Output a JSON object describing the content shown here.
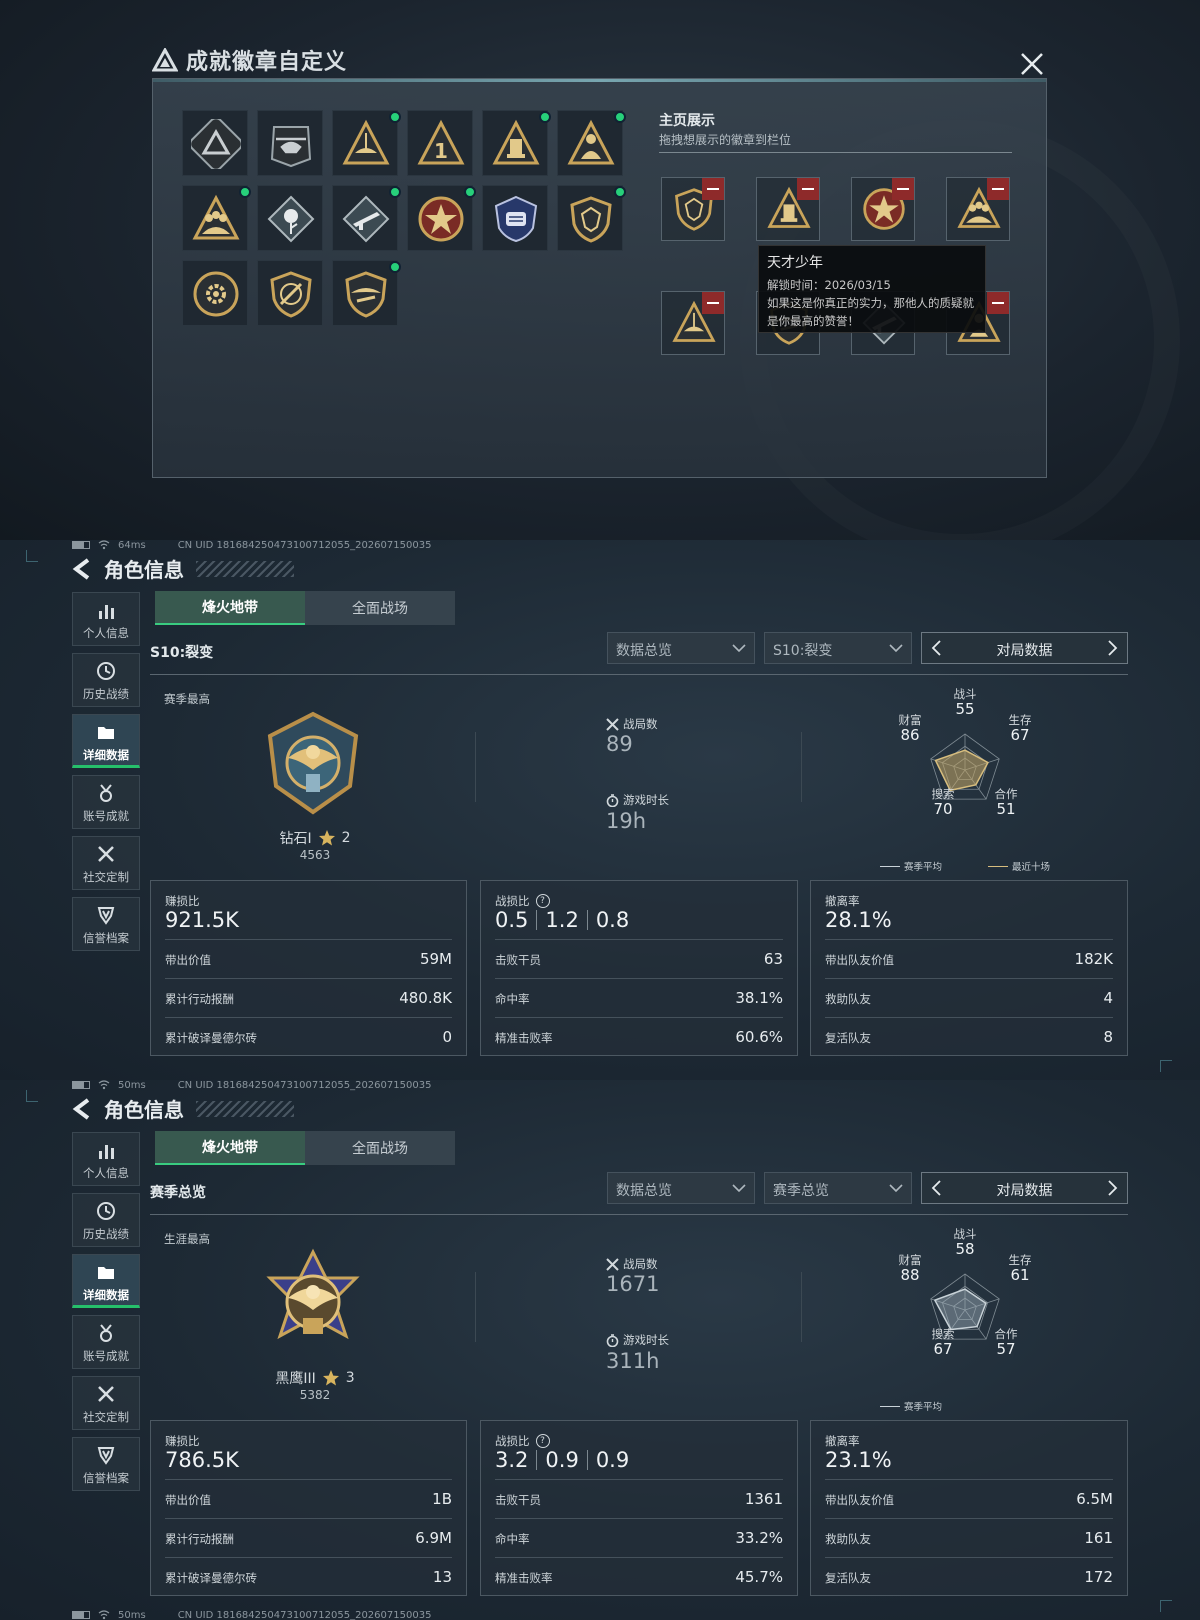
{
  "dialog": {
    "title": "成就徽章自定义",
    "showcase_title": "主页展示",
    "showcase_sub": "拖拽想展示的徽章到栏位",
    "tooltip": {
      "name": "天才少年",
      "unlock_time": "解锁时间：2026/03/15",
      "desc_line1": "如果这是你真正的实力，那他人的质疑就",
      "desc_line2": "是你最高的赞誉！"
    },
    "badges": [
      {
        "icon": "triangle-emblem",
        "new": false
      },
      {
        "icon": "helicopter-emblem",
        "new": false
      },
      {
        "icon": "boat-emblem",
        "new": true
      },
      {
        "icon": "number-one-emblem",
        "new": false
      },
      {
        "icon": "tower-emblem",
        "new": true
      },
      {
        "icon": "soldier-emblem",
        "new": true
      },
      {
        "icon": "squad-emblem",
        "new": true
      },
      {
        "icon": "rose-emblem",
        "new": false
      },
      {
        "icon": "rifle-emblem",
        "new": true
      },
      {
        "icon": "star-medal-emblem",
        "new": true
      },
      {
        "icon": "police-emblem",
        "new": false
      },
      {
        "icon": "shield-emblem",
        "new": true
      },
      {
        "icon": "cog-emblem",
        "new": false
      },
      {
        "icon": "no-knife-emblem",
        "new": false
      },
      {
        "icon": "wing-shield-emblem",
        "new": true
      }
    ],
    "slots": [
      {
        "icon": "shield-emblem",
        "removable": true
      },
      {
        "icon": "tower-emblem",
        "removable": true
      },
      {
        "icon": "star-medal-emblem",
        "removable": true
      },
      {
        "icon": "squad-emblem",
        "removable": true
      },
      {
        "icon": "boat-emblem",
        "removable": true
      },
      {
        "icon": "wing-shield-emblem",
        "removable": false
      },
      {
        "icon": "rifle-emblem",
        "removable": false
      },
      {
        "icon": "soldier-emblem",
        "removable": true
      }
    ]
  },
  "panels": [
    {
      "status": {
        "latency": "64ms",
        "uid": "CN UID 181684250473100712055_202607150035"
      },
      "header_title": "角色信息",
      "nav": [
        "个人信息",
        "历史战绩",
        "详细数据",
        "账号成就",
        "社交定制",
        "信誉档案"
      ],
      "active_nav": 2,
      "tabs": [
        "烽火地带",
        "全面战场"
      ],
      "section_title": "S10:裂变",
      "dropdown1": "数据总览",
      "dropdown2": "S10:裂变",
      "pager_label": "对局数据",
      "best_label": "赛季最高",
      "rank_name": "钻石I",
      "rank_stars": "2",
      "rank_score": "4563",
      "matches_label": "战局数",
      "matches": "89",
      "playtime_label": "游戏时长",
      "playtime": "19h",
      "radar": {
        "labels": {
          "combat": "战斗",
          "survive": "生存",
          "coop": "合作",
          "search": "搜索",
          "wealth": "财富"
        },
        "values": {
          "combat": "55",
          "survive": "67",
          "coop": "51",
          "search": "70",
          "wealth": "86"
        },
        "legend_avg": "赛季平均",
        "legend_recent": "最近十场"
      },
      "card1": {
        "label": "赚损比",
        "big": "921.5K",
        "rows": [
          [
            "带出价值",
            "59M"
          ],
          [
            "累计行动报酬",
            "480.8K"
          ],
          [
            "累计破译曼德尔砖",
            "0"
          ]
        ]
      },
      "card2": {
        "label": "战损比",
        "kd": [
          "0.5",
          "1.2",
          "0.8"
        ],
        "rows": [
          [
            "击败干员",
            "63"
          ],
          [
            "命中率",
            "38.1%"
          ],
          [
            "精准击败率",
            "60.6%"
          ]
        ]
      },
      "card3": {
        "label": "撤离率",
        "big": "28.1%",
        "rows": [
          [
            "带出队友价值",
            "182K"
          ],
          [
            "救助队友",
            "4"
          ],
          [
            "复活队友",
            "8"
          ]
        ]
      }
    },
    {
      "status": {
        "latency": "50ms",
        "uid": "CN UID 181684250473100712055_202607150035"
      },
      "header_title": "角色信息",
      "nav": [
        "个人信息",
        "历史战绩",
        "详细数据",
        "账号成就",
        "社交定制",
        "信誉档案"
      ],
      "active_nav": 2,
      "tabs": [
        "烽火地带",
        "全面战场"
      ],
      "section_title": "赛季总览",
      "dropdown1": "数据总览",
      "dropdown2": "赛季总览",
      "pager_label": "对局数据",
      "best_label": "生涯最高",
      "rank_name": "黑鹰III",
      "rank_stars": "3",
      "rank_score": "5382",
      "matches_label": "战局数",
      "matches": "1671",
      "playtime_label": "游戏时长",
      "playtime": "311h",
      "radar": {
        "labels": {
          "combat": "战斗",
          "survive": "生存",
          "coop": "合作",
          "search": "搜索",
          "wealth": "财富"
        },
        "values": {
          "combat": "58",
          "survive": "61",
          "coop": "57",
          "search": "67",
          "wealth": "88"
        },
        "legend_avg": "赛季平均",
        "legend_recent": ""
      },
      "card1": {
        "label": "赚损比",
        "big": "786.5K",
        "rows": [
          [
            "带出价值",
            "1B"
          ],
          [
            "累计行动报酬",
            "6.9M"
          ],
          [
            "累计破译曼德尔砖",
            "13"
          ]
        ]
      },
      "card2": {
        "label": "战损比",
        "kd": [
          "3.2",
          "0.9",
          "0.9"
        ],
        "rows": [
          [
            "击败干员",
            "1361"
          ],
          [
            "命中率",
            "33.2%"
          ],
          [
            "精准击败率",
            "45.7%"
          ]
        ]
      },
      "card3": {
        "label": "撤离率",
        "big": "23.1%",
        "rows": [
          [
            "带出队友价值",
            "6.5M"
          ],
          [
            "救助队友",
            "161"
          ],
          [
            "复活队友",
            "172"
          ]
        ]
      }
    }
  ],
  "bottom_status": {
    "latency": "50ms",
    "uid": "CN UID 181684250473100712055_202607150035"
  }
}
